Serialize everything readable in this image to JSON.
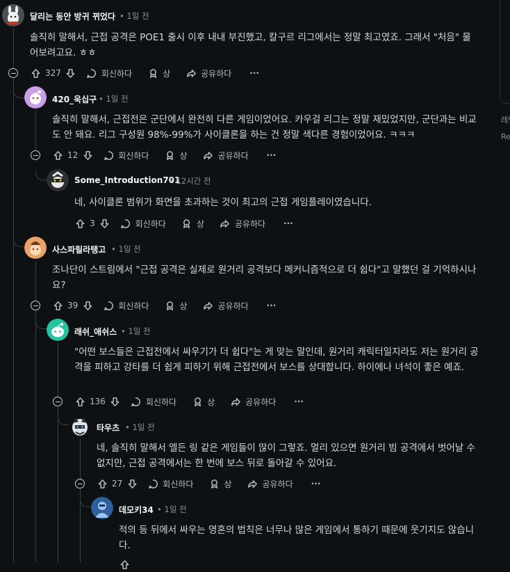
{
  "labels": {
    "reply": "회신하다",
    "award": "상",
    "share": "공유하다",
    "more": "···"
  },
  "sidebar": {
    "line1": "레딧",
    "line2": "Re"
  },
  "comments": [
    {
      "author": "달리는 동안 방귀 뀌었다",
      "time": "1일 전",
      "text": "솔직히 말해서, 근접 공격은 POE1 출시 이후 내내 부진했고, 칼구르 리그에서는 정말 최고였죠. 그래서 \"처음\" 물어보려고요. ㅎㅎ",
      "score": "327"
    },
    {
      "author": "420_욱십구",
      "time": "1일 전",
      "text": "솔직히 말해서, 근접전은 군단에서 완전히 다른 게임이었어요. 카우걸 리그는 정말 재밌었지만, 군단과는 비교도 안 돼요. 리그 구성원 98%-99%가 사이클론을 하는 건 정말 색다른 경험이었어요. ㅋㅋㅋ",
      "score": "12"
    },
    {
      "author": "Some_Introduction701",
      "time": "12시간 전",
      "text": "네, 사이클론 범위가 화면을 초과하는 것이 최고의 근접 게임플레이였습니다.",
      "score": "3"
    },
    {
      "author": "사스파릴라탱고",
      "time": "1일 전",
      "text": "조나단이 스트림에서 \"근접 공격은 실제로 원거리 공격보다 메커니즘적으로 더 쉽다\"고 말했던 걸 기억하시나요?",
      "score": "39"
    },
    {
      "author": "래쉬_애쉬스",
      "time": "1일 전",
      "text": "\"어떤 보스들은 근접전에서 싸우기가 더 쉽다\"는 게 맞는 말인데, 원거리 캐릭터일지라도 저는 원거리 공격을 피하고 강타를 더 쉽게 피하기 위해 근접전에서 보스를 상대합니다. 하이에나 녀석이 좋은 예죠.",
      "score": "136"
    },
    {
      "author": "타우츠",
      "time": "1일 전",
      "text": "네, 솔직히 말해서 엘든 링 같은 게임들이 많이 그렇죠. 멀리 있으면 원거리 빔 공격에서 벗어날 수 없지만, 근접 공격에서는 한 번에 보스 뒤로 돌아갈 수 있어요.",
      "score": "27"
    },
    {
      "author": "데모키34",
      "time": "1일 전",
      "text": "적의 등 뒤에서 싸우는 영혼의 법칙은 너무나 많은 게임에서 통하기 때문에 웃기지도 않습니다.",
      "score": ""
    }
  ]
}
